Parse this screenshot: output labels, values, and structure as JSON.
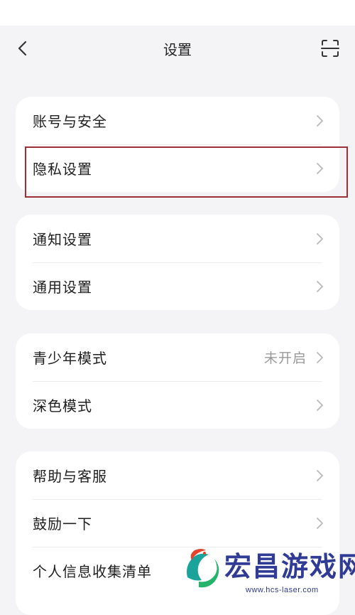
{
  "header": {
    "title": "设置"
  },
  "groups": [
    {
      "items": [
        {
          "label": "账号与安全"
        },
        {
          "label": "隐私设置"
        }
      ]
    },
    {
      "items": [
        {
          "label": "通知设置"
        },
        {
          "label": "通用设置"
        }
      ]
    },
    {
      "items": [
        {
          "label": "青少年模式",
          "value": "未开启"
        },
        {
          "label": "深色模式"
        }
      ]
    },
    {
      "items": [
        {
          "label": "帮助与客服"
        },
        {
          "label": "鼓励一下"
        },
        {
          "label": "个人信息收集清单"
        }
      ]
    }
  ],
  "watermark": {
    "title": "宏昌游戏网",
    "url": "www.hcs-laser.com"
  },
  "colors": {
    "background": "#f4f4f6",
    "card": "#ffffff",
    "highlight_border": "#9b3036",
    "watermark": "#2f3b94"
  },
  "icons": {
    "back": "chevron-left-icon",
    "scan": "scan-icon",
    "row_arrow": "chevron-right-icon"
  }
}
